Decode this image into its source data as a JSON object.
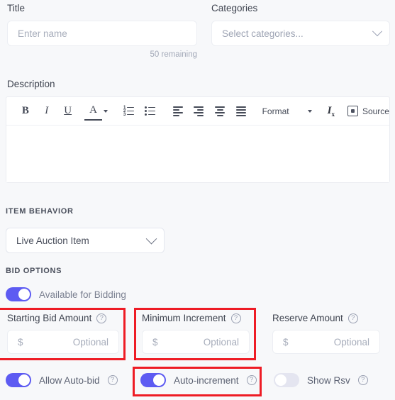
{
  "title_field": {
    "label": "Title",
    "placeholder": "Enter name",
    "value": "",
    "helper": "50 remaining"
  },
  "categories_field": {
    "label": "Categories",
    "placeholder": "Select categories...",
    "value": "",
    "chevron_icon": "chevron-down-icon"
  },
  "description": {
    "label": "Description",
    "body_value": "",
    "toolbar": {
      "bold": "B",
      "italic": "I",
      "underline": "U",
      "text_color": "A",
      "numbered_list_icon": "numbered-list-icon",
      "bulleted_list_icon": "bulleted-list-icon",
      "align_left_icon": "align-left-icon",
      "align_right_icon": "align-right-icon",
      "align_center_icon": "align-center-icon",
      "align_justify_icon": "align-justify-icon",
      "format_label": "Format",
      "remove_format": "I",
      "remove_format_sub": "x",
      "source_label": "Source"
    }
  },
  "item_behavior": {
    "section_label": "ITEM BEHAVIOR",
    "selected": "Live Auction Item",
    "chevron_icon": "chevron-down-icon"
  },
  "bid_options": {
    "section_label": "BID OPTIONS",
    "available_for_bidding": {
      "label": "Available for Bidding",
      "state": "on"
    },
    "amounts": [
      {
        "label": "Starting Bid Amount",
        "currency": "$",
        "placeholder": "Optional",
        "value": "",
        "help_icon": "help-icon",
        "highlighted": true
      },
      {
        "label": "Minimum Increment",
        "currency": "$",
        "placeholder": "Optional",
        "value": "",
        "help_icon": "help-icon",
        "highlighted": true
      },
      {
        "label": "Reserve Amount",
        "currency": "$",
        "placeholder": "Optional",
        "value": "",
        "help_icon": "help-icon",
        "highlighted": false
      }
    ],
    "toggles": [
      {
        "label": "Allow Auto-bid",
        "state": "on",
        "help_icon": "help-icon",
        "highlighted": false
      },
      {
        "label": "Auto-increment",
        "state": "on",
        "help_icon": "help-icon",
        "highlighted": true
      },
      {
        "label": "Show Rsv",
        "state": "off",
        "help_icon": "help-icon",
        "highlighted": false
      }
    ]
  },
  "colors": {
    "accent": "#5d5bf2",
    "highlight": "#ee1c25",
    "page_bg": "#f7f8fa",
    "toggle_off": "#e4e5f0"
  },
  "glyphs": {
    "help": "?",
    "currency": "$"
  }
}
